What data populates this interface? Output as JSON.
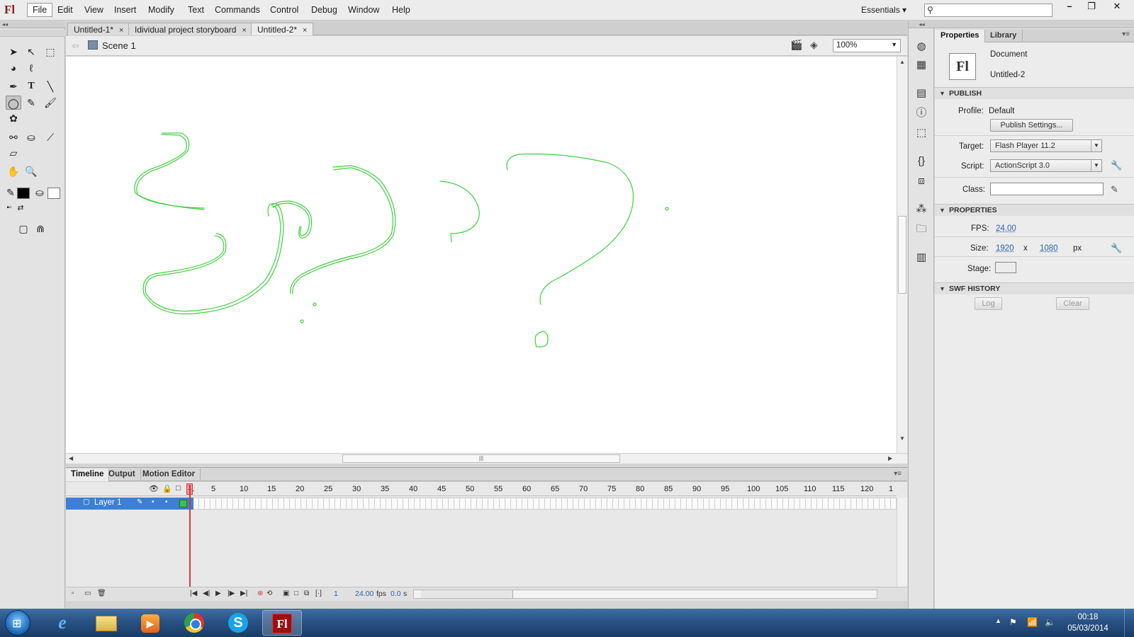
{
  "app": {
    "logo": "Fl"
  },
  "menu": [
    "File",
    "Edit",
    "View",
    "Insert",
    "Modify",
    "Text",
    "Commands",
    "Control",
    "Debug",
    "Window",
    "Help"
  ],
  "workspace": {
    "label": "Essentials",
    "arrow": "▾"
  },
  "search": {
    "placeholder": "",
    "icon": "search-icon"
  },
  "window_controls": [
    "–",
    "❐",
    "✕"
  ],
  "doc_tabs": [
    {
      "label": "Untitled-1*",
      "close": "×"
    },
    {
      "label": "Idividual project storyboard",
      "close": "×"
    },
    {
      "label": "Untitled-2*",
      "close": "×"
    }
  ],
  "edit_bar": {
    "scene": "Scene 1",
    "zoom": "100%"
  },
  "timeline": {
    "tabs": [
      "Timeline",
      "Output",
      "Motion Editor"
    ],
    "frame_numbers": [
      "1",
      "5",
      "10",
      "15",
      "20",
      "25",
      "30",
      "35",
      "40",
      "45",
      "50",
      "55",
      "60",
      "65",
      "70",
      "75",
      "80",
      "85",
      "90",
      "95",
      "100",
      "105",
      "110",
      "115",
      "120",
      "1"
    ],
    "layer": {
      "name": "Layer 1"
    },
    "current_frame": "1",
    "fps": "24.00",
    "fps_unit": "fps",
    "time": "0.0",
    "time_unit": "s"
  },
  "properties": {
    "tabs": [
      "Properties",
      "Library"
    ],
    "doc_icon": "Fl",
    "doc_type": "Document",
    "doc_name": "Untitled-2",
    "publish": {
      "title": "PUBLISH",
      "profile_label": "Profile:",
      "profile_value": "Default",
      "settings_button": "Publish Settings...",
      "target_label": "Target:",
      "target_value": "Flash Player 11.2",
      "script_label": "Script:",
      "script_value": "ActionScript 3.0",
      "class_label": "Class:",
      "class_value": ""
    },
    "props": {
      "title": "PROPERTIES",
      "fps_label": "FPS:",
      "fps_value": "24.00",
      "size_label": "Size:",
      "width": "1920",
      "x": "x",
      "height": "1080",
      "unit": "px",
      "stage_label": "Stage:",
      "stage_color": "#ececec"
    },
    "swf_history": {
      "title": "SWF HISTORY",
      "log": "Log",
      "clear": "Clear"
    }
  },
  "taskbar": {
    "apps": [
      "internet-explorer",
      "file-explorer",
      "media-player",
      "chrome",
      "skype",
      "flash"
    ],
    "flash_label": "Fl",
    "skype_label": "S",
    "time": "00:18",
    "date": "05/03/2014"
  },
  "colors": {
    "stroke": "#3fd03f",
    "layer_selected": "#3b7fd6",
    "playhead": "#d23a3a"
  }
}
